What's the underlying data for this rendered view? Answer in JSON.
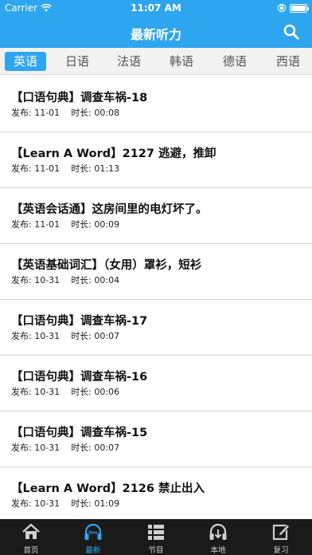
{
  "status": {
    "carrier": "Carrier",
    "time": "11:07 AM"
  },
  "header": {
    "title": "最新听力"
  },
  "tabs": [
    {
      "label": "英语",
      "active": true
    },
    {
      "label": "日语",
      "active": false
    },
    {
      "label": "法语",
      "active": false
    },
    {
      "label": "韩语",
      "active": false
    },
    {
      "label": "德语",
      "active": false
    },
    {
      "label": "西语",
      "active": false
    }
  ],
  "meta_labels": {
    "publish": "发布:",
    "duration": "时长:"
  },
  "items": [
    {
      "title": "【口语句典】调查车祸-18",
      "date": "11-01",
      "duration": "00:08"
    },
    {
      "title": "【Learn A Word】2127 逃避，推卸",
      "date": "11-01",
      "duration": "01:13"
    },
    {
      "title": "【英语会话通】这房间里的电灯坏了。",
      "date": "11-01",
      "duration": "00:09"
    },
    {
      "title": "【英语基础词汇】（女用）罩衫，短衫",
      "date": "10-31",
      "duration": "00:04"
    },
    {
      "title": "【口语句典】调查车祸-17",
      "date": "10-31",
      "duration": "00:07"
    },
    {
      "title": "【口语句典】调查车祸-16",
      "date": "10-31",
      "duration": "00:06"
    },
    {
      "title": "【口语句典】调查车祸-15",
      "date": "10-31",
      "duration": "00:07"
    },
    {
      "title": "【Learn A Word】2126 禁止出入",
      "date": "10-31",
      "duration": "01:09"
    }
  ],
  "tabbar": [
    {
      "label": "首页",
      "icon": "home-icon",
      "active": false
    },
    {
      "label": "最新",
      "icon": "new-headphones-icon",
      "active": true,
      "badge": "New"
    },
    {
      "label": "节目",
      "icon": "list-icon",
      "active": false
    },
    {
      "label": "本地",
      "icon": "download-headphones-icon",
      "active": false
    },
    {
      "label": "复习",
      "icon": "edit-icon",
      "active": false
    }
  ],
  "colors": {
    "primary": "#2ea5ef",
    "tabbar_bg": "#1a1a1a"
  }
}
